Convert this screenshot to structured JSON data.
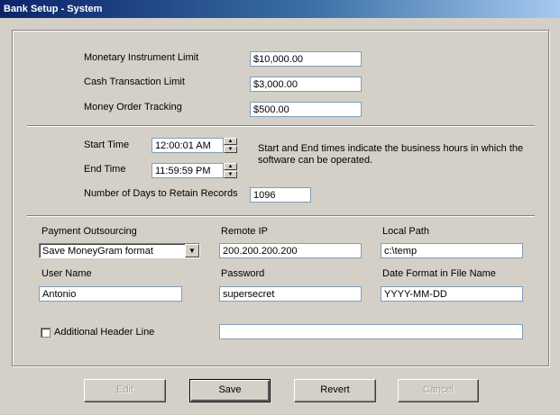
{
  "window": {
    "title": "Bank Setup - System"
  },
  "limits": {
    "monetary_instrument_label": "Monetary Instrument Limit",
    "monetary_instrument_value": "$10,000.00",
    "cash_transaction_label": "Cash Transaction Limit",
    "cash_transaction_value": "$3,000.00",
    "money_order_label": "Money Order Tracking",
    "money_order_value": "$500.00"
  },
  "hours": {
    "start_label": "Start Time",
    "start_value": "12:00:01 AM",
    "end_label": "End Time",
    "end_value": "11:59:59 PM",
    "note": "Start and End times indicate the business hours in which the software can be operated.",
    "retain_label": "Number of Days to Retain Records",
    "retain_value": "1096"
  },
  "outsourcing": {
    "payment_label": "Payment Outsourcing",
    "payment_value": "Save MoneyGram format",
    "remote_ip_label": "Remote IP",
    "remote_ip_value": "200.200.200.200",
    "local_path_label": "Local Path",
    "local_path_value": "c:\\temp",
    "username_label": "User Name",
    "username_value": "Antonio",
    "password_label": "Password",
    "password_value": "supersecret",
    "date_format_label": "Date Format in File Name",
    "date_format_value": "YYYY-MM-DD",
    "header_line_label": "Additional Header Line",
    "header_line_checked": false,
    "header_line_value": ""
  },
  "buttons": {
    "edit": "Edit",
    "save": "Save",
    "revert": "Revert",
    "cancel": "Cancel"
  }
}
